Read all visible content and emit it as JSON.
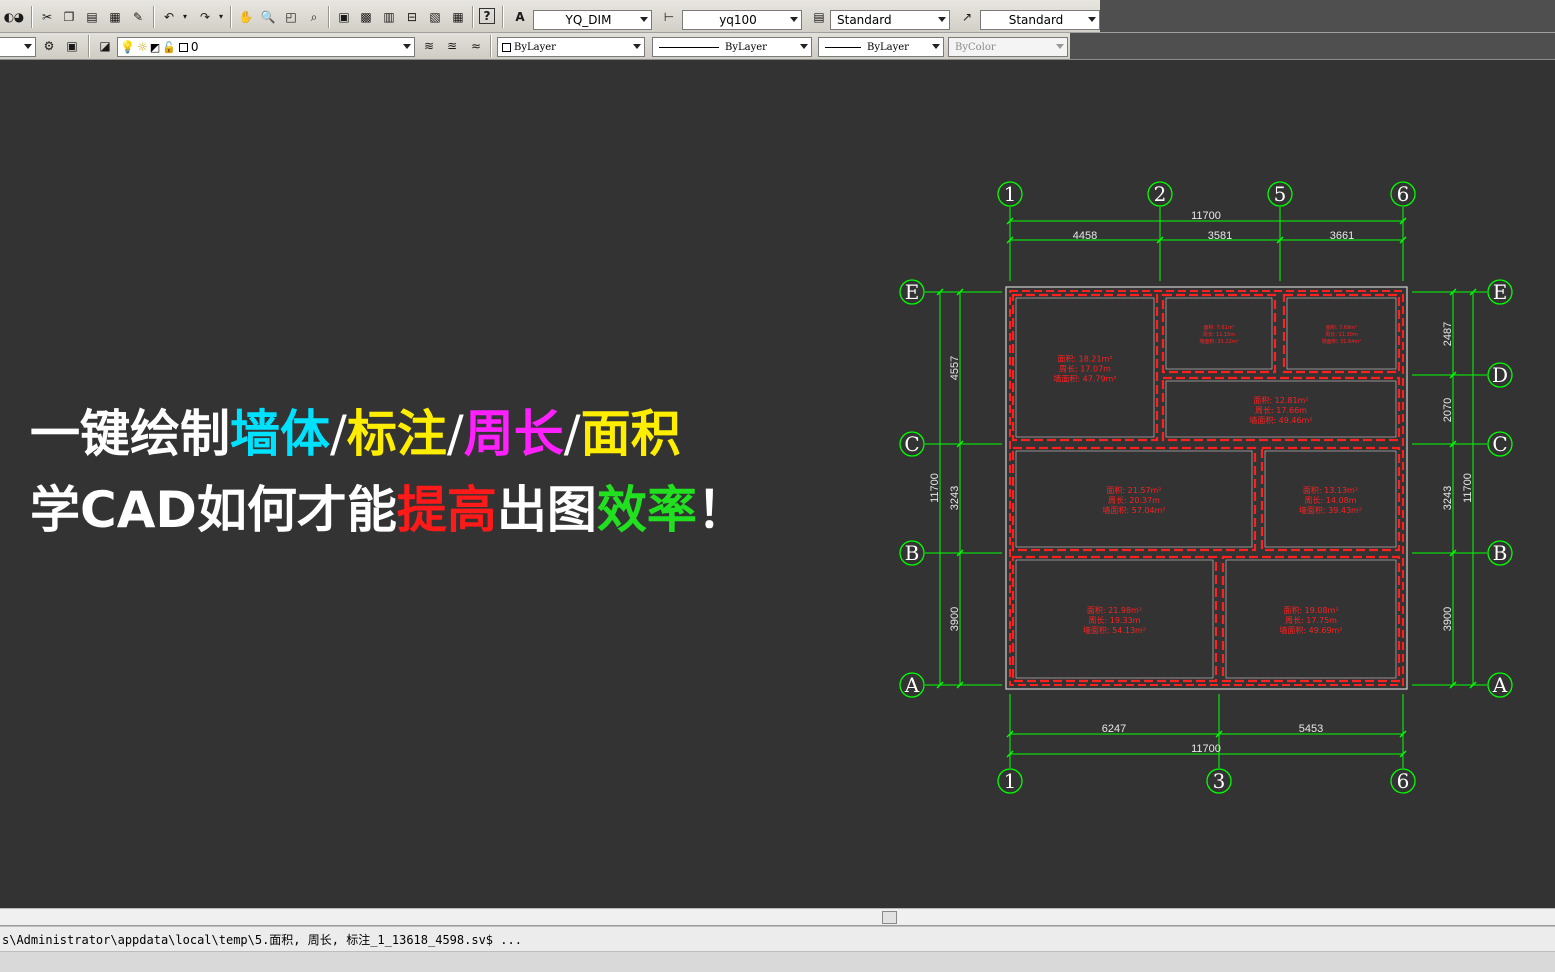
{
  "toolbar_standard": {
    "text_style": "YQ_DIM",
    "dim_style": "yq100",
    "table_style": "Standard",
    "multileader_style": "Standard"
  },
  "toolbar_layers": {
    "layer_value": "0",
    "color": "ByLayer",
    "linetype": "ByLayer",
    "lineweight": "ByLayer",
    "plot_style": "ByColor"
  },
  "overlay": {
    "line1": [
      {
        "text": "一键绘制",
        "color": "#ffffff"
      },
      {
        "text": "墙体",
        "color": "#00e0ff"
      },
      {
        "text": "/",
        "color": "#ffffff",
        "slash": true
      },
      {
        "text": "标注",
        "color": "#ffee00"
      },
      {
        "text": "/",
        "color": "#ffffff",
        "slash": true
      },
      {
        "text": "周长",
        "color": "#ff20ff"
      },
      {
        "text": "/",
        "color": "#ffffff",
        "slash": true
      },
      {
        "text": "面积",
        "color": "#ffee00"
      }
    ],
    "line2": [
      {
        "text": "学CAD如何才能",
        "color": "#ffffff"
      },
      {
        "text": "提高",
        "color": "#ff1a1a"
      },
      {
        "text": "出图",
        "color": "#ffffff"
      },
      {
        "text": "效率",
        "color": "#20e020"
      },
      {
        "text": "！",
        "color": "#ffffff"
      }
    ]
  },
  "drawing": {
    "colors": {
      "grid": "#00ff00",
      "wall": "#ff2020",
      "outline": "#d0d0d0",
      "dim_text": "#e8e8e8"
    },
    "axes_top": [
      "1",
      "2",
      "5",
      "6"
    ],
    "axes_bottom": [
      "1",
      "3",
      "6"
    ],
    "axes_left": [
      "E",
      "C",
      "B",
      "A"
    ],
    "axes_right": [
      "E",
      "D",
      "C",
      "B",
      "A"
    ],
    "dims_top_total": "11700",
    "dims_top": [
      "4458",
      "3581",
      "3661"
    ],
    "dims_bottom": [
      "6247",
      "5453"
    ],
    "dims_bottom_total": "11700",
    "dims_left": [
      "4557",
      "3243",
      "3900"
    ],
    "dims_left_total": "11700",
    "dims_right": [
      "2487",
      "2070",
      "3243",
      "3900"
    ],
    "dims_right_total": "11700",
    "rooms": [
      {
        "lines": [
          "面积: 18.21m²",
          "周长: 17.07m",
          "墙面积: 47.79m²"
        ]
      },
      {
        "lines": [
          "面积: 7.61m²",
          "周长: 11.15m",
          "墙面积: 31.22m²"
        ]
      },
      {
        "lines": [
          "面积: 7.69m²",
          "周长: 11.30m",
          "墙面积: 31.64m²"
        ]
      },
      {
        "lines": [
          "面积: 12.81m²",
          "周长: 17.66m",
          "墙面积: 49.46m²"
        ]
      },
      {
        "lines": [
          "面积: 21.57m²",
          "周长: 20.37m",
          "墙面积: 57.04m²"
        ]
      },
      {
        "lines": [
          "面积: 13.13m²",
          "周长: 14.08m",
          "墙面积: 39.43m²"
        ]
      },
      {
        "lines": [
          "面积: 21.98m²",
          "周长: 19.33m",
          "墙面积: 54.13m²"
        ]
      },
      {
        "lines": [
          "面积: 19.08m²",
          "周长: 17.75m",
          "墙面积: 49.69m²"
        ]
      }
    ]
  },
  "command_line": {
    "text": "s\\Administrator\\appdata\\local\\temp\\5.面积, 周长, 标注_1_13618_4598.sv$ ..."
  }
}
